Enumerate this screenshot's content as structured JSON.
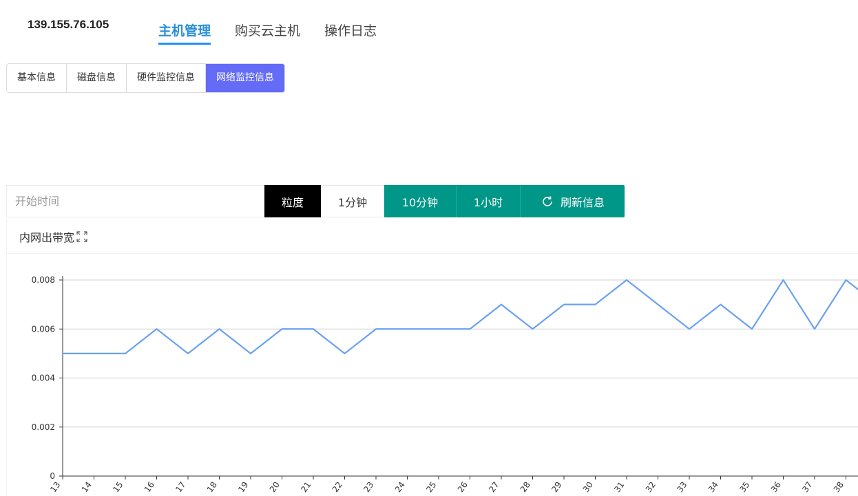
{
  "header": {
    "host_ip": "139.155.76.105",
    "nav": [
      {
        "label": "主机管理",
        "active": true
      },
      {
        "label": "购买云主机",
        "active": false
      },
      {
        "label": "操作日志",
        "active": false
      }
    ]
  },
  "sub_tabs": [
    {
      "label": "基本信息",
      "active": false
    },
    {
      "label": "磁盘信息",
      "active": false
    },
    {
      "label": "硬件监控信息",
      "active": false
    },
    {
      "label": "网络监控信息",
      "active": true
    }
  ],
  "toolbar": {
    "start_placeholder": "开始时间",
    "granularity_label": "粒度",
    "btn_1min": "1分钟",
    "btn_10min": "10分钟",
    "btn_1hour": "1小时",
    "btn_refresh": "刷新信息"
  },
  "colors": {
    "accent_blue": "#2a8fd6",
    "active_tab": "#636bf7",
    "teal": "#009688",
    "line": "#6aa1f2"
  },
  "chart_data": {
    "type": "line",
    "title": "内网出带宽",
    "x": [
      "13",
      "14",
      "15",
      "16",
      "17",
      "18",
      "19",
      "20",
      "21",
      "22",
      "23",
      "24",
      "25",
      "26",
      "27",
      "28",
      "29",
      "30",
      "31",
      "32",
      "33",
      "34",
      "35",
      "36",
      "37",
      "38"
    ],
    "series": [
      {
        "values": [
          0.005,
          0.005,
          0.005,
          0.006,
          0.005,
          0.006,
          0.005,
          0.006,
          0.006,
          0.005,
          0.006,
          0.006,
          0.006,
          0.006,
          0.007,
          0.006,
          0.007,
          0.007,
          0.008,
          0.007,
          0.006,
          0.007,
          0.006,
          0.008,
          0.006,
          0.008,
          0.007
        ]
      }
    ],
    "ylim": [
      0,
      0.008
    ],
    "yticks": [
      "0",
      "0.002",
      "0.004",
      "0.006",
      "0.008"
    ],
    "grid": true
  }
}
